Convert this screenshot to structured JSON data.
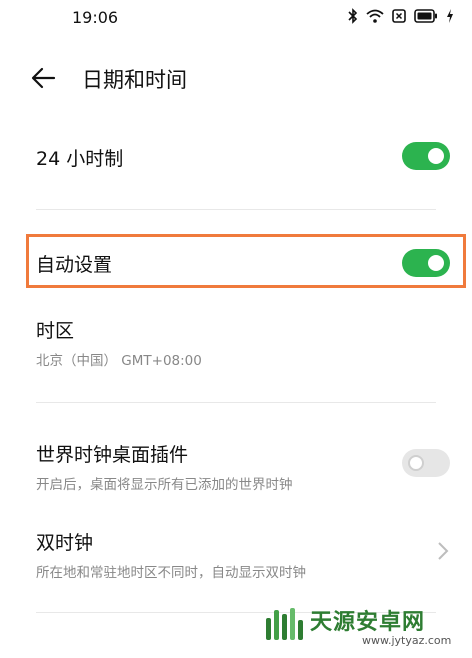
{
  "status_bar": {
    "time": "19:06",
    "icons": [
      "bluetooth-icon",
      "wifi-icon",
      "sim-icon",
      "battery-icon",
      "charging-icon"
    ]
  },
  "header": {
    "title": "日期和时间",
    "back_icon": "arrow-left-icon"
  },
  "settings": {
    "hour24": {
      "label": "24 小时制",
      "enabled": true
    },
    "auto_set": {
      "label": "自动设置",
      "enabled": true
    },
    "time_zone": {
      "label": "时区",
      "value": "北京（中国） GMT+08:00"
    },
    "world_clock_widget": {
      "label": "世界时钟桌面插件",
      "description": "开启后，桌面将显示所有已添加的世界时钟",
      "enabled": false
    },
    "dual_clock": {
      "label": "双时钟",
      "description": "所在地和常驻地时区不同时，自动显示双时钟"
    }
  },
  "colors": {
    "toggle_on": "#2cb34f",
    "toggle_off": "#e6e6e6",
    "highlight": "#f07a3c",
    "watermark": "#2e7d32"
  },
  "watermark": {
    "name": "天源安卓网",
    "url": "www.jytyaz.com"
  }
}
